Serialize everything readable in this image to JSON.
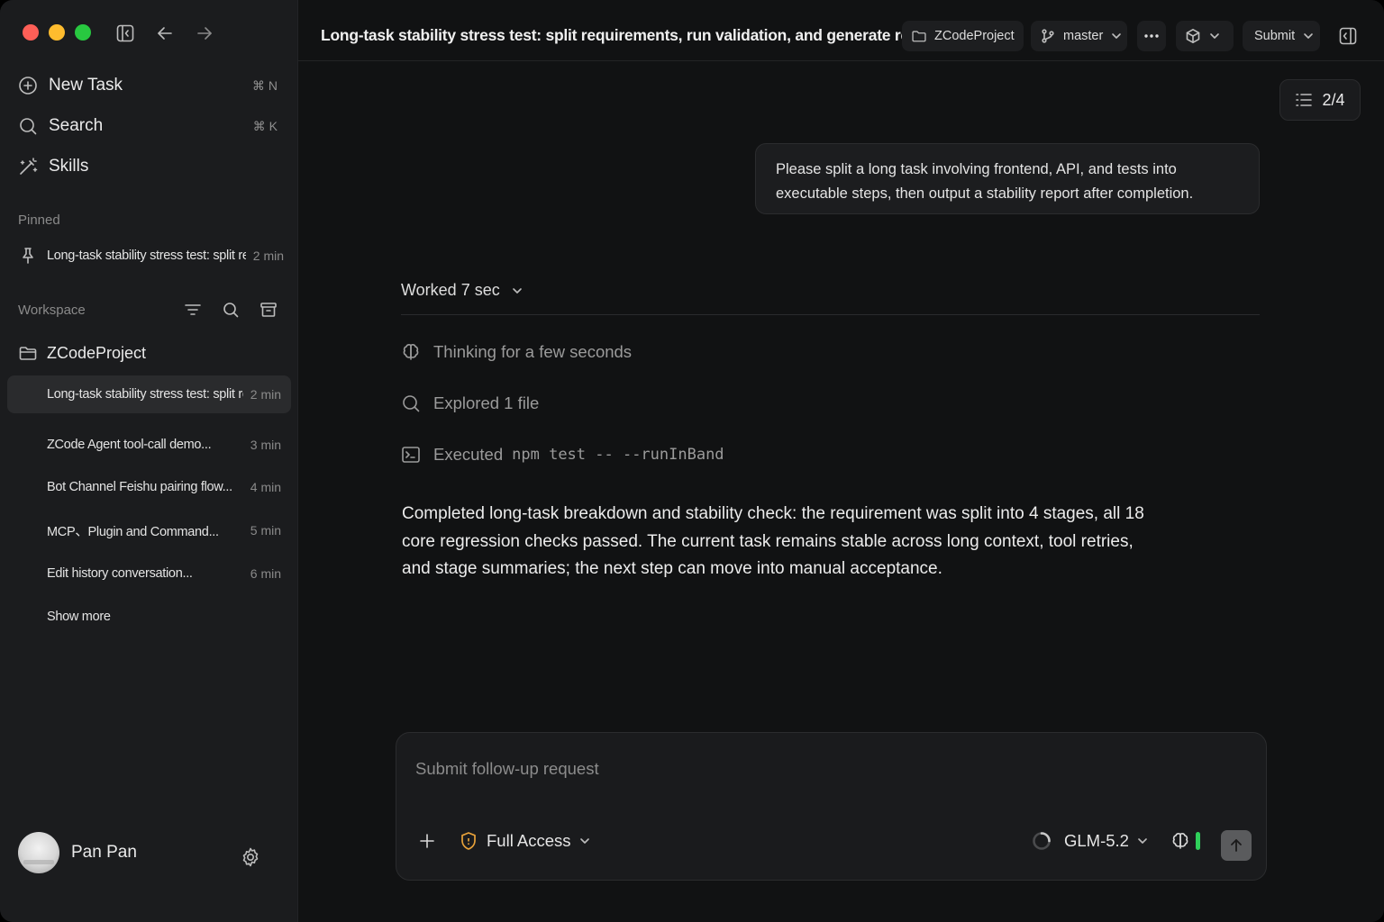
{
  "window": {
    "title": "Long-task stability stress test: split requirements, run validation, and generate report"
  },
  "sidebar": {
    "nav": [
      {
        "label": "New Task",
        "shortcut": "⌘ N",
        "icon": "plus-circle-icon"
      },
      {
        "label": "Search",
        "shortcut": "⌘ K",
        "icon": "search-icon"
      },
      {
        "label": "Skills",
        "shortcut": "",
        "icon": "magic-wand-icon"
      }
    ],
    "pinned_title": "Pinned",
    "pinned": [
      {
        "title": "Long-task stability stress test: split requ...",
        "time": "2 min"
      }
    ],
    "workspace_title": "Workspace",
    "project_name": "ZCodeProject",
    "tasks": [
      {
        "title": "Long-task stability stress test: split requ...",
        "time": "2 min",
        "active": true
      },
      {
        "title": "ZCode Agent tool-call demo...",
        "time": "3 min"
      },
      {
        "title": "Bot Channel Feishu pairing flow...",
        "time": "4 min"
      },
      {
        "title": "MCP、Plugin and Command...",
        "time": "5 min"
      },
      {
        "title": "Edit history conversation...",
        "time": "6 min"
      }
    ],
    "show_more": "Show more",
    "user_name": "Pan Pan"
  },
  "header": {
    "project_chip": "ZCodeProject",
    "branch_chip": "master",
    "submit_label": "Submit"
  },
  "content": {
    "step_counter": "2/4",
    "user_message": "Please split a long task involving frontend, API, and tests into executable steps, then output a stability report after completion.",
    "worked_label": "Worked 7 sec",
    "activities": [
      {
        "icon": "brain-icon",
        "prefix": "Thinking for a few seconds",
        "code": ""
      },
      {
        "icon": "search-icon",
        "prefix": "Explored 1 file",
        "code": ""
      },
      {
        "icon": "terminal-icon",
        "prefix": "Executed",
        "code": "npm test -- --runInBand"
      }
    ],
    "answer": "Completed long-task breakdown and stability check: the requirement was split into 4 stages, all 18 core regression checks passed. The current task remains stable across long context, tool retries, and stage summaries; the next step can move into manual acceptance."
  },
  "composer": {
    "placeholder": "Submit follow-up request",
    "access_label": "Full Access",
    "model_label": "GLM-5.2"
  },
  "colors": {
    "close": "#fe5f57",
    "minimize": "#febc2e",
    "maximize": "#28c840",
    "accent_orange": "#e8a23a",
    "status_green": "#2fd05a"
  }
}
